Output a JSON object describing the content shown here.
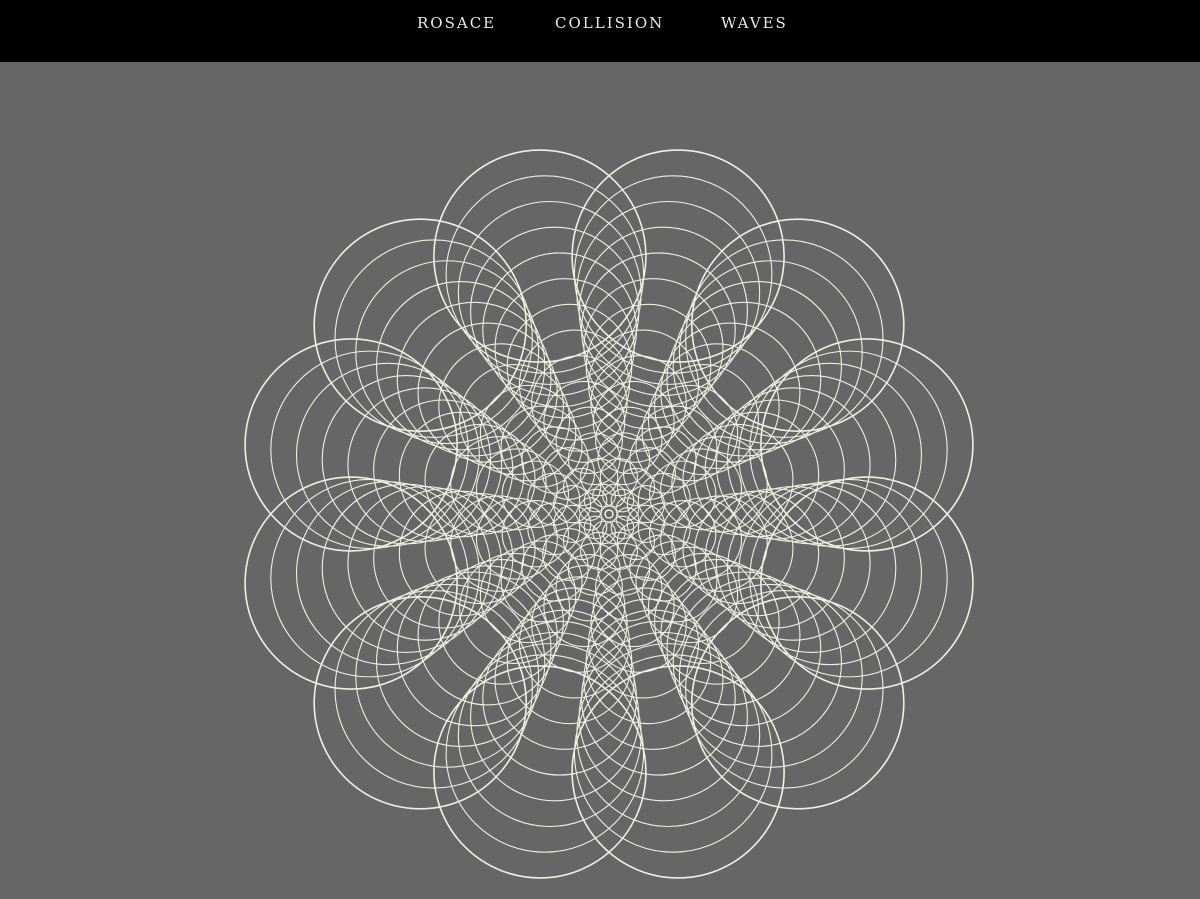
{
  "nav": {
    "items": [
      {
        "label": "ROSACE"
      },
      {
        "label": "COLLISION"
      },
      {
        "label": "WAVES"
      }
    ]
  },
  "colors": {
    "topbar": "#000000",
    "background": "#666666",
    "nav_text": "#ece9df",
    "stroke": "#eef0e2"
  },
  "rosace": {
    "petals": 12,
    "rings_per_petal": 15
  }
}
